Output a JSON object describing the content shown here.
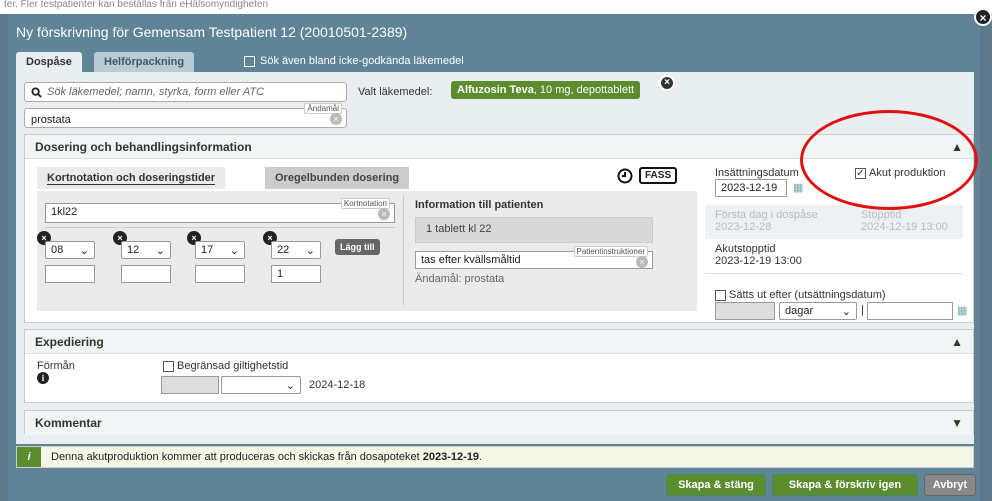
{
  "top_strip": "ter. Fler testpatienter kan beställas från eHälsomyndigheten",
  "window": {
    "title": "Ny förskrivning för Gemensam Testpatient 12 (20010501-2389)",
    "close": "×"
  },
  "tabs": [
    "Dospåse",
    "Helförpackning"
  ],
  "include_unapproved": "Sök även bland icke-godkända läkemedel",
  "search": {
    "placeholder": "Sök läkemedel; namn, styrka, form eller ATC"
  },
  "selected": {
    "label": "Valt läkemedel:",
    "name": "Alfuzosin Teva",
    "detail": ", 10 mg, depottablett"
  },
  "purpose": {
    "tag": "Ändamål",
    "value": "prostata"
  },
  "dosing": {
    "header": "Dosering och behandlingsinformation",
    "subtabs": [
      "Kortnotation och doseringstider",
      "Oregelbunden dosering"
    ],
    "fass": "FASS",
    "short_tag": "Kortnotation",
    "short_value": "1kl22",
    "times": [
      "08",
      "12",
      "17",
      "22"
    ],
    "amounts": [
      "",
      "",
      "",
      "1"
    ],
    "add_button": "Lägg till",
    "patient_info_title": "Information till patienten",
    "patient_info_text": "1 tablett kl 22",
    "instructions_tag": "Patientinstruktioner",
    "instructions_value": "tas efter kvällsmåltid",
    "purpose_text": "Ändamål: prostata",
    "start_label": "Insättningsdatum",
    "start_value": "2023-12-19",
    "acute_label": "Akut produktion",
    "first_day_label": "Första dag i dospåse",
    "first_day_value": "2023-12-28",
    "stop_label": "Stopptid",
    "stop_value": "2024-12-19 13:00",
    "acute_stop_label": "Akutstopptid",
    "acute_stop_value": "2023-12-19 13:00",
    "withdraw_label": "Sätts ut efter (utsättningsdatum)",
    "days_option": "dagar"
  },
  "dispensing": {
    "header": "Expediering",
    "benefit": "Förmån",
    "limited": "Begränsad giltighetstid",
    "date": "2024-12-18"
  },
  "comment": {
    "header": "Kommentar"
  },
  "info": {
    "text": "Denna akutproduktion kommer att produceras och skickas från dosapoteket ",
    "date": "2023-12-19",
    "end": "."
  },
  "buttons": {
    "create_close": "Skapa & stäng",
    "create_again": "Skapa & förskriv igen",
    "cancel": "Avbryt"
  },
  "colors": {
    "green": "#5b8c2e",
    "dialog_bg": "#5f8497",
    "annotation": "#e01010"
  }
}
